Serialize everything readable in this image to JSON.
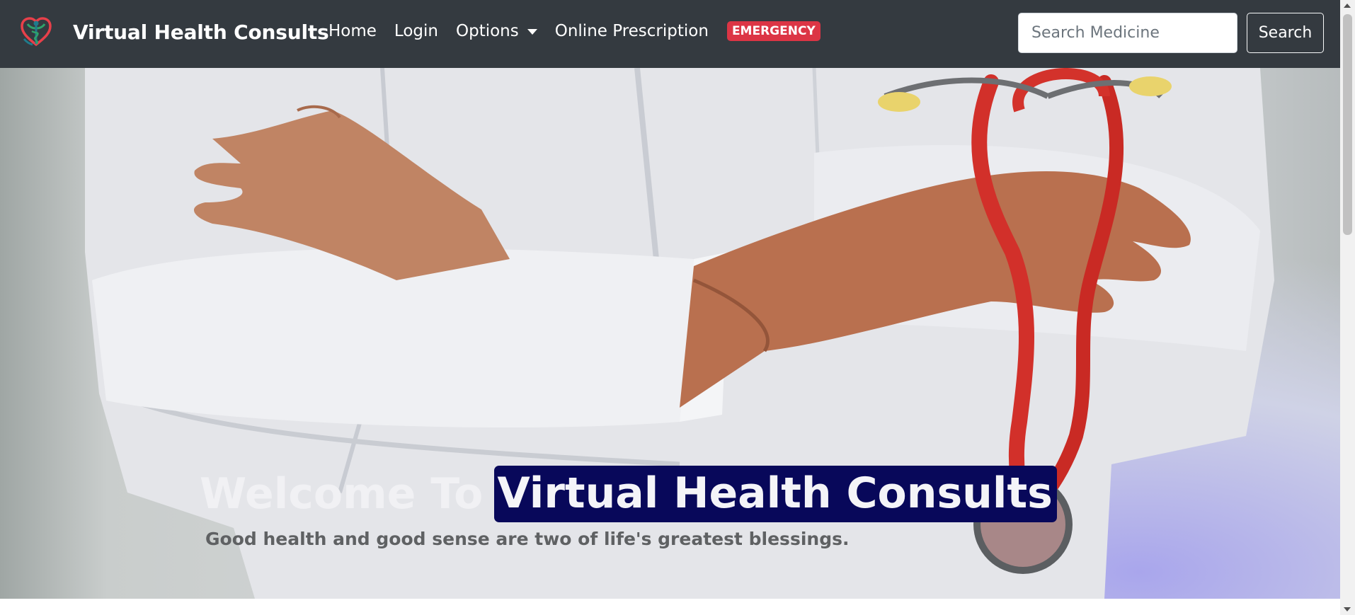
{
  "navbar": {
    "brand": "Virtual Health Consults",
    "logo_icon": "heart-caduceus-icon",
    "links": {
      "home": "Home",
      "login": "Login",
      "options": "Options",
      "online_prescription": "Online Prescription"
    },
    "emergency_badge": "EMERGENCY",
    "search": {
      "placeholder": "Search Medicine",
      "value": "",
      "button_label": "Search"
    }
  },
  "hero": {
    "title_prefix": "Welcome To",
    "title_highlight": "Virtual Health Consults",
    "subtitle": "Good health and good sense are two of life's greatest blessings.",
    "image_subject": "doctor-with-stethoscope"
  },
  "colors": {
    "navbar_bg": "#343a40",
    "emergency": "#dc3545",
    "highlight_bg": "#08085a"
  }
}
